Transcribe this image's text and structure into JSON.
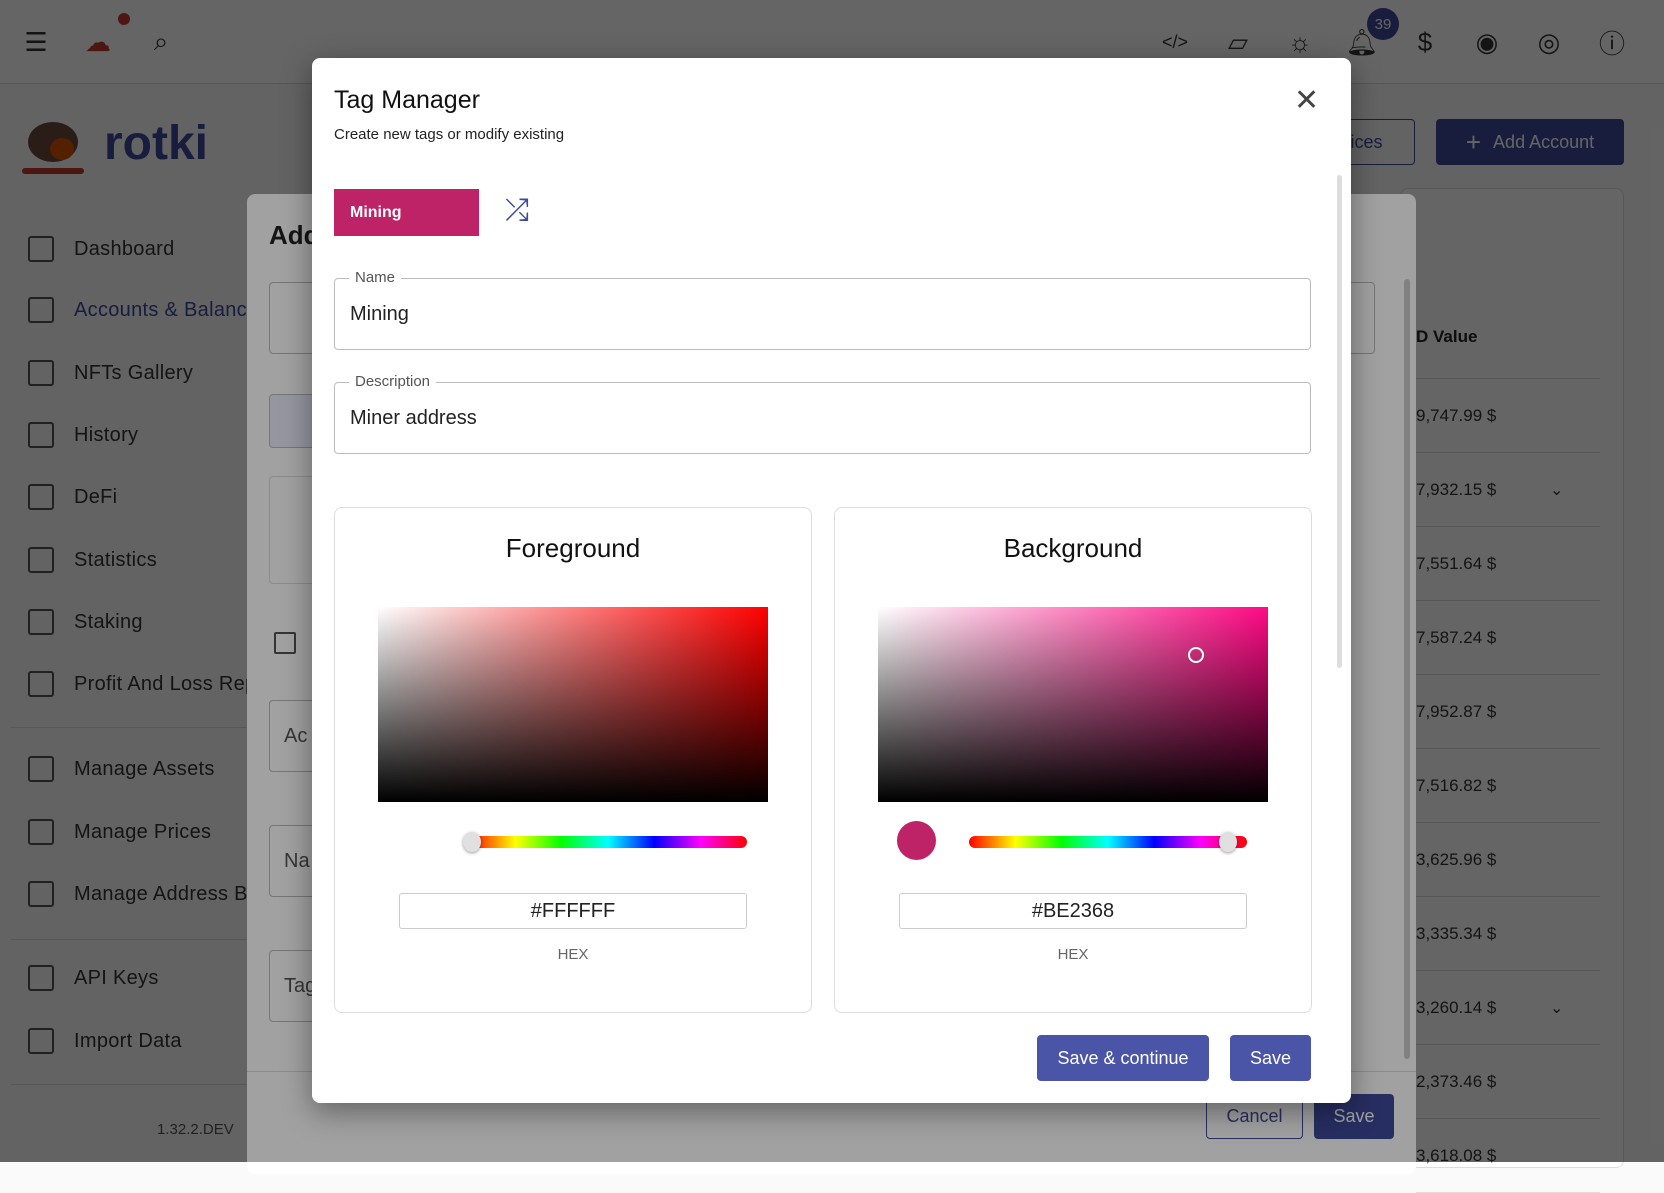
{
  "topbar": {
    "notification_count": "39",
    "icons": [
      "menu-icon",
      "cloud-off-icon",
      "search-icon",
      "code-icon",
      "note-icon",
      "theme-sun-icon",
      "bell-icon",
      "dollar-icon",
      "eye-icon",
      "account-icon",
      "help-icon"
    ]
  },
  "brand": {
    "name": "rotki"
  },
  "sidebar": {
    "items": [
      {
        "label": "Dashboard"
      },
      {
        "label": "Accounts & Balances"
      },
      {
        "label": "NFTs Gallery"
      },
      {
        "label": "History"
      },
      {
        "label": "DeFi"
      },
      {
        "label": "Statistics"
      },
      {
        "label": "Staking"
      },
      {
        "label": "Profit And Loss Report"
      },
      {
        "label": "Manage Assets"
      },
      {
        "label": "Manage Prices"
      },
      {
        "label": "Manage Address Book"
      },
      {
        "label": "API Keys"
      },
      {
        "label": "Import Data"
      }
    ],
    "version": "1.32.2.DEV"
  },
  "toolbar": {
    "prices_label": "Prices",
    "add_account_label": "Add Account"
  },
  "table": {
    "header": "D Value",
    "values": [
      "9,747.99 $",
      "7,932.15 $",
      "7,551.64 $",
      "7,587.24 $",
      "7,952.87 $",
      "7,516.82 $",
      "3,625.96 $",
      "3,335.34 $",
      "3,260.14 $",
      "2,373.46 $",
      "3,618.08 $"
    ]
  },
  "add_dialog": {
    "title": "Add",
    "fields": [
      "Ac",
      "Na",
      "Tag"
    ],
    "cancel_label": "Cancel",
    "save_label": "Save"
  },
  "modal": {
    "title": "Tag Manager",
    "subtitle": "Create new tags or modify existing",
    "preview_tag": "Mining",
    "name": {
      "label": "Name",
      "value": "Mining"
    },
    "description": {
      "label": "Description",
      "value": "Miner address"
    },
    "foreground": {
      "title": "Foreground",
      "hex": "#FFFFFF",
      "hex_label": "HEX",
      "hue_fraction": 0
    },
    "background": {
      "title": "Background",
      "hex": "#BE2368",
      "hex_label": "HEX",
      "hue_fraction": 0.93
    },
    "save_continue_label": "Save & continue",
    "save_label": "Save"
  },
  "colors": {
    "accent": "#4b55a8",
    "tag_bg": "#BE2368",
    "tag_fg": "#FFFFFF"
  }
}
